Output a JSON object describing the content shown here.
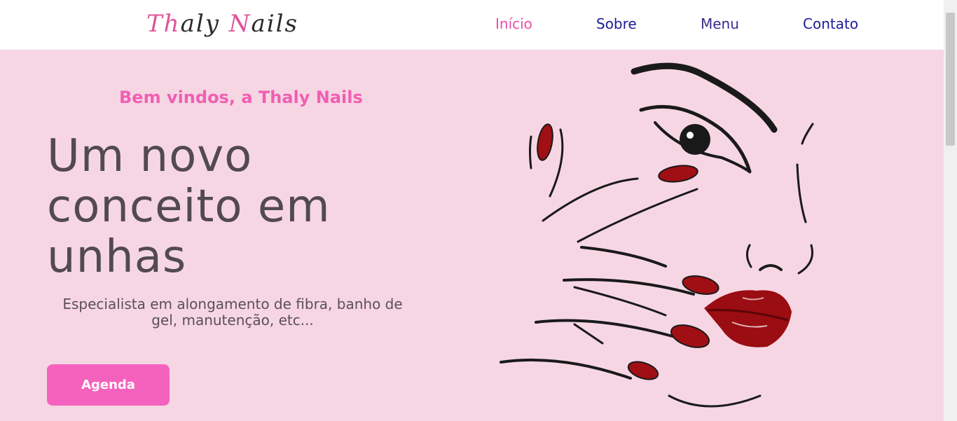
{
  "header": {
    "logo": {
      "part1": "Th",
      "part2": "aly ",
      "part3": "N",
      "part4": "ails"
    },
    "nav": [
      {
        "label": "Início"
      },
      {
        "label": "Sobre"
      },
      {
        "label": "Menu"
      },
      {
        "label": "Contato"
      }
    ]
  },
  "hero": {
    "welcome": "Bem vindos, a Thaly Nails",
    "headline": "Um novo conceito em unhas",
    "subtitle": "Especialista em alongamento de fibra, banho de gel, manutenção, etc...",
    "cta_label": "Agenda"
  },
  "colors": {
    "hero_bg": "#f7d6e4",
    "accent_pink": "#f562bd",
    "nav_active": "#e94ea7",
    "nav_link": "#1b1b9a",
    "nail_red": "#a00f14"
  },
  "icons": [
    "nails-face-illustration"
  ]
}
